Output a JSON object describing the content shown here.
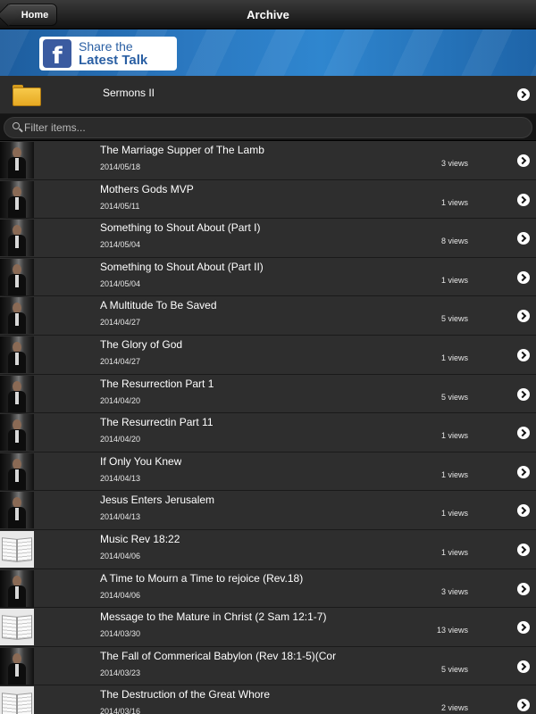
{
  "navbar": {
    "title": "Archive",
    "home_label": "Home"
  },
  "banner": {
    "share_line1": "Share the",
    "share_line2": "Latest Talk",
    "fb_glyph": "f",
    "brand_color": "#3b5ba0"
  },
  "folder": {
    "label": "Sermons II",
    "icon": "folder-icon"
  },
  "filter": {
    "placeholder": "Filter items..."
  },
  "items": [
    {
      "title": "The Marriage Supper of The Lamb",
      "date": "2014/05/18",
      "views": "3 views",
      "thumb": "person"
    },
    {
      "title": "Mothers Gods MVP",
      "date": "2014/05/11",
      "views": "1 views",
      "thumb": "person"
    },
    {
      "title": "Something to Shout About (Part I)",
      "date": "2014/05/04",
      "views": "8 views",
      "thumb": "person"
    },
    {
      "title": "Something to Shout About (Part II)",
      "date": "2014/05/04",
      "views": "1 views",
      "thumb": "person"
    },
    {
      "title": "A Multitude To Be Saved",
      "date": "2014/04/27",
      "views": "5 views",
      "thumb": "person"
    },
    {
      "title": "The Glory of God",
      "date": "2014/04/27",
      "views": "1 views",
      "thumb": "person"
    },
    {
      "title": "The Resurrection Part 1",
      "date": "2014/04/20",
      "views": "5 views",
      "thumb": "person"
    },
    {
      "title": "The Resurrectin Part 11",
      "date": "2014/04/20",
      "views": "1 views",
      "thumb": "person"
    },
    {
      "title": "If Only You Knew",
      "date": "2014/04/13",
      "views": "1 views",
      "thumb": "person"
    },
    {
      "title": "Jesus Enters Jerusalem",
      "date": "2014/04/13",
      "views": "1 views",
      "thumb": "person"
    },
    {
      "title": "Music Rev 18:22",
      "date": "2014/04/06",
      "views": "1 views",
      "thumb": "book"
    },
    {
      "title": "A Time to Mourn a Time to rejoice (Rev.18)",
      "date": "2014/04/06",
      "views": "3 views",
      "thumb": "person"
    },
    {
      "title": "Message to the Mature in Christ (2 Sam 12:1-7)",
      "date": "2014/03/30",
      "views": "13 views",
      "thumb": "book"
    },
    {
      "title": "The Fall of Commerical Babylon (Rev 18:1-5)(Cor",
      "date": "2014/03/23",
      "views": "5 views",
      "thumb": "person"
    },
    {
      "title": "The Destruction of the Great Whore",
      "date": "2014/03/16",
      "views": "2 views",
      "thumb": "book"
    }
  ]
}
